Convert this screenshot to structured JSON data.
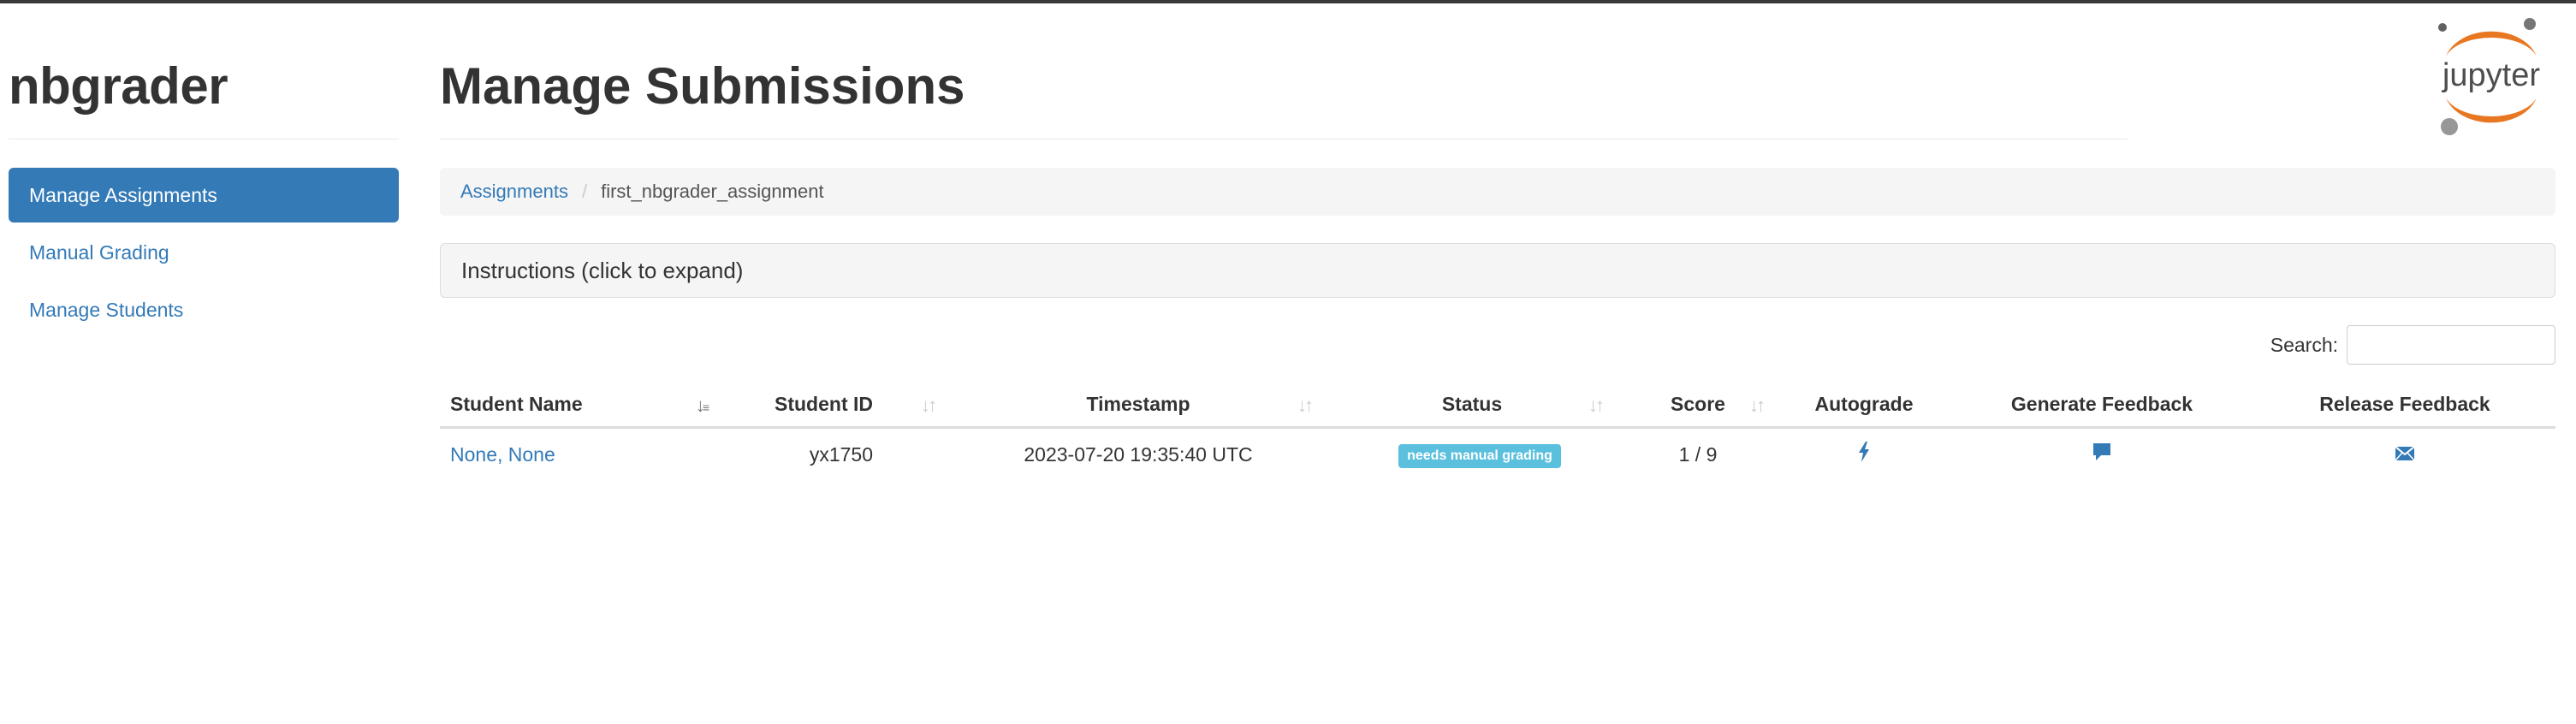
{
  "sidebar": {
    "brand": "nbgrader",
    "items": [
      {
        "label": "Manage Assignments",
        "active": true
      },
      {
        "label": "Manual Grading",
        "active": false
      },
      {
        "label": "Manage Students",
        "active": false
      }
    ]
  },
  "header": {
    "title": "Manage Submissions",
    "logo_text": "jupyter"
  },
  "breadcrumb": {
    "root": "Assignments",
    "separator": "/",
    "current": "first_nbgrader_assignment"
  },
  "instructions": {
    "label": "Instructions (click to expand)"
  },
  "search": {
    "label": "Search:",
    "value": "",
    "placeholder": ""
  },
  "table": {
    "columns": [
      "Student Name",
      "Student ID",
      "Timestamp",
      "Status",
      "Score",
      "Autograde",
      "Generate Feedback",
      "Release Feedback"
    ],
    "rows": [
      {
        "name": "None, None",
        "student_id": "yx1750",
        "timestamp": "2023-07-20 19:35:40 UTC",
        "status": "needs manual grading",
        "score": "1 / 9",
        "autograde_icon": "bolt-icon",
        "generate_feedback_icon": "comment-icon",
        "release_feedback_icon": "envelope-icon"
      }
    ]
  },
  "colors": {
    "accent": "#337ab7",
    "badge": "#5bc0de",
    "logo_orange": "#e87722",
    "logo_gray": "#767677"
  }
}
